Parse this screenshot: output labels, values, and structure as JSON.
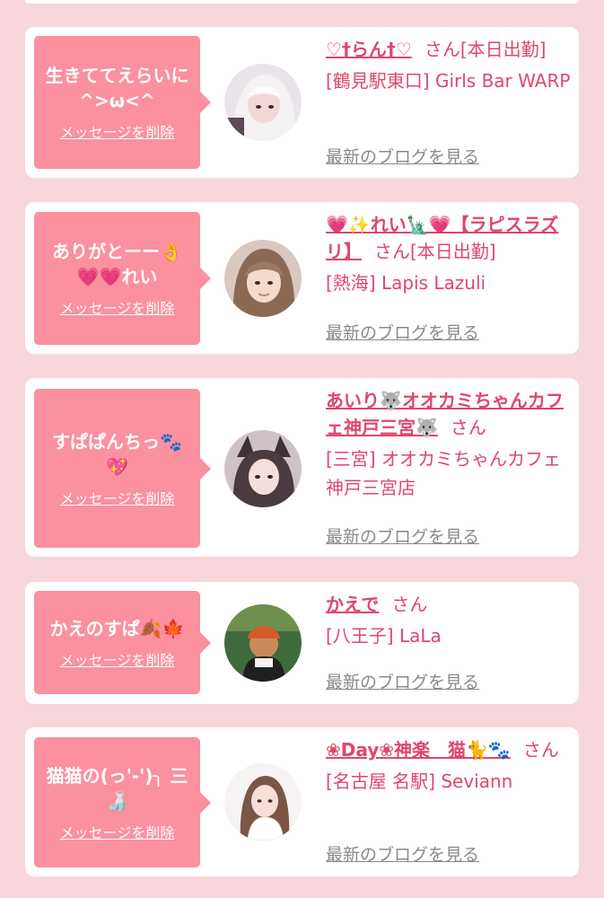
{
  "delete_label": "メッセージを削除",
  "blog_label": "最新のブログを見る",
  "san_label": "さん",
  "messages": [
    {
      "message": "生きててえらいに\n^>ω<^",
      "cast_name": "♡†らん†♡",
      "status": "[本日出勤]",
      "shop": "[鶴見駅東口] Girls Bar WARP"
    },
    {
      "message": "ありがとーー👌\n💗💗れい",
      "cast_name": "💗✨れい🗽💗【ラピスラズリ】",
      "status": "[本日出勤]",
      "shop": "[熱海] Lapis Lazuli"
    },
    {
      "message": "すぱぱんちっ🐾\n💖",
      "cast_name": "あいり🐺オオカミちゃんカフェ神戸三宮🐺",
      "status": "",
      "shop": "[三宮] オオカミちゃんカフェ神戸三宮店"
    },
    {
      "message": "かえのすぱ🍂🍁",
      "cast_name": "かえで",
      "status": "",
      "shop": "[八王子] LaLa"
    },
    {
      "message": "猫猫の(っ'-')╮ 三\n🍶",
      "cast_name": "❀Day❀神楽　猫🐈🐾",
      "status": "",
      "shop": "[名古屋 名駅] Seviann"
    }
  ]
}
